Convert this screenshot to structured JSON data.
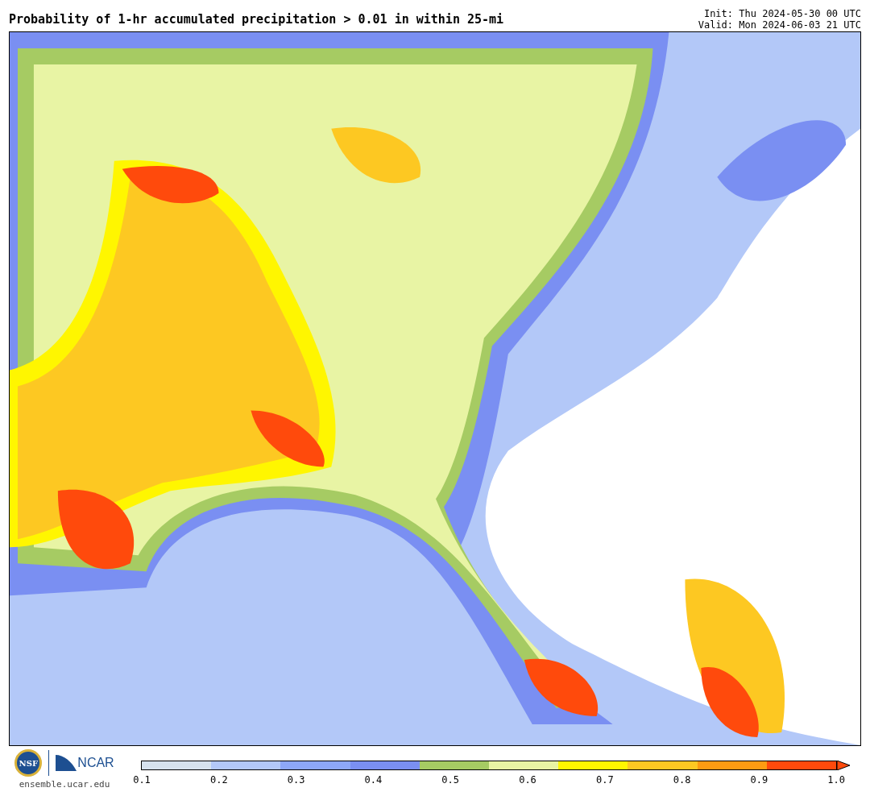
{
  "title": "Probability of 1-hr accumulated precipitation > 0.01 in within 25-mi",
  "init": "Init: Thu 2024-05-30 00 UTC",
  "valid": "Valid: Mon 2024-06-03 21 UTC",
  "logos": {
    "nsf": "NSF",
    "ncar": "NCAR"
  },
  "site": "ensemble.ucar.edu",
  "colorbar": {
    "bins": [
      {
        "color": "#d6e2ee"
      },
      {
        "color": "#b3c8f8"
      },
      {
        "color": "#8da7f7"
      },
      {
        "color": "#7a8ff2"
      },
      {
        "color": "#a6cb63"
      },
      {
        "color": "#e8f4a4"
      },
      {
        "color": "#fff600"
      },
      {
        "color": "#fdc822"
      },
      {
        "color": "#fd9b12"
      },
      {
        "color": "#ff4a0c"
      }
    ],
    "ticks": [
      "0.1",
      "0.2",
      "0.3",
      "0.4",
      "0.5",
      "0.6",
      "0.7",
      "0.8",
      "0.9",
      "1.0"
    ]
  }
}
